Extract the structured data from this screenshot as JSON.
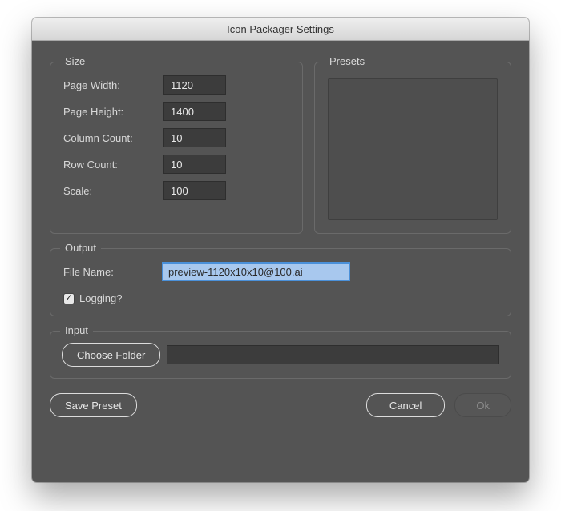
{
  "window": {
    "title": "Icon Packager Settings"
  },
  "size": {
    "group_label": "Size",
    "page_width_label": "Page Width:",
    "page_width_value": "1120",
    "page_height_label": "Page Height:",
    "page_height_value": "1400",
    "column_count_label": "Column Count:",
    "column_count_value": "10",
    "row_count_label": "Row Count:",
    "row_count_value": "10",
    "scale_label": "Scale:",
    "scale_value": "100"
  },
  "presets": {
    "group_label": "Presets"
  },
  "output": {
    "group_label": "Output",
    "file_name_label": "File Name:",
    "file_name_value": "preview-1120x10x10@100.ai",
    "logging_label": "Logging?",
    "logging_checked": true
  },
  "input": {
    "group_label": "Input",
    "choose_folder_label": "Choose Folder",
    "folder_path": ""
  },
  "buttons": {
    "save_preset": "Save Preset",
    "cancel": "Cancel",
    "ok": "Ok"
  }
}
